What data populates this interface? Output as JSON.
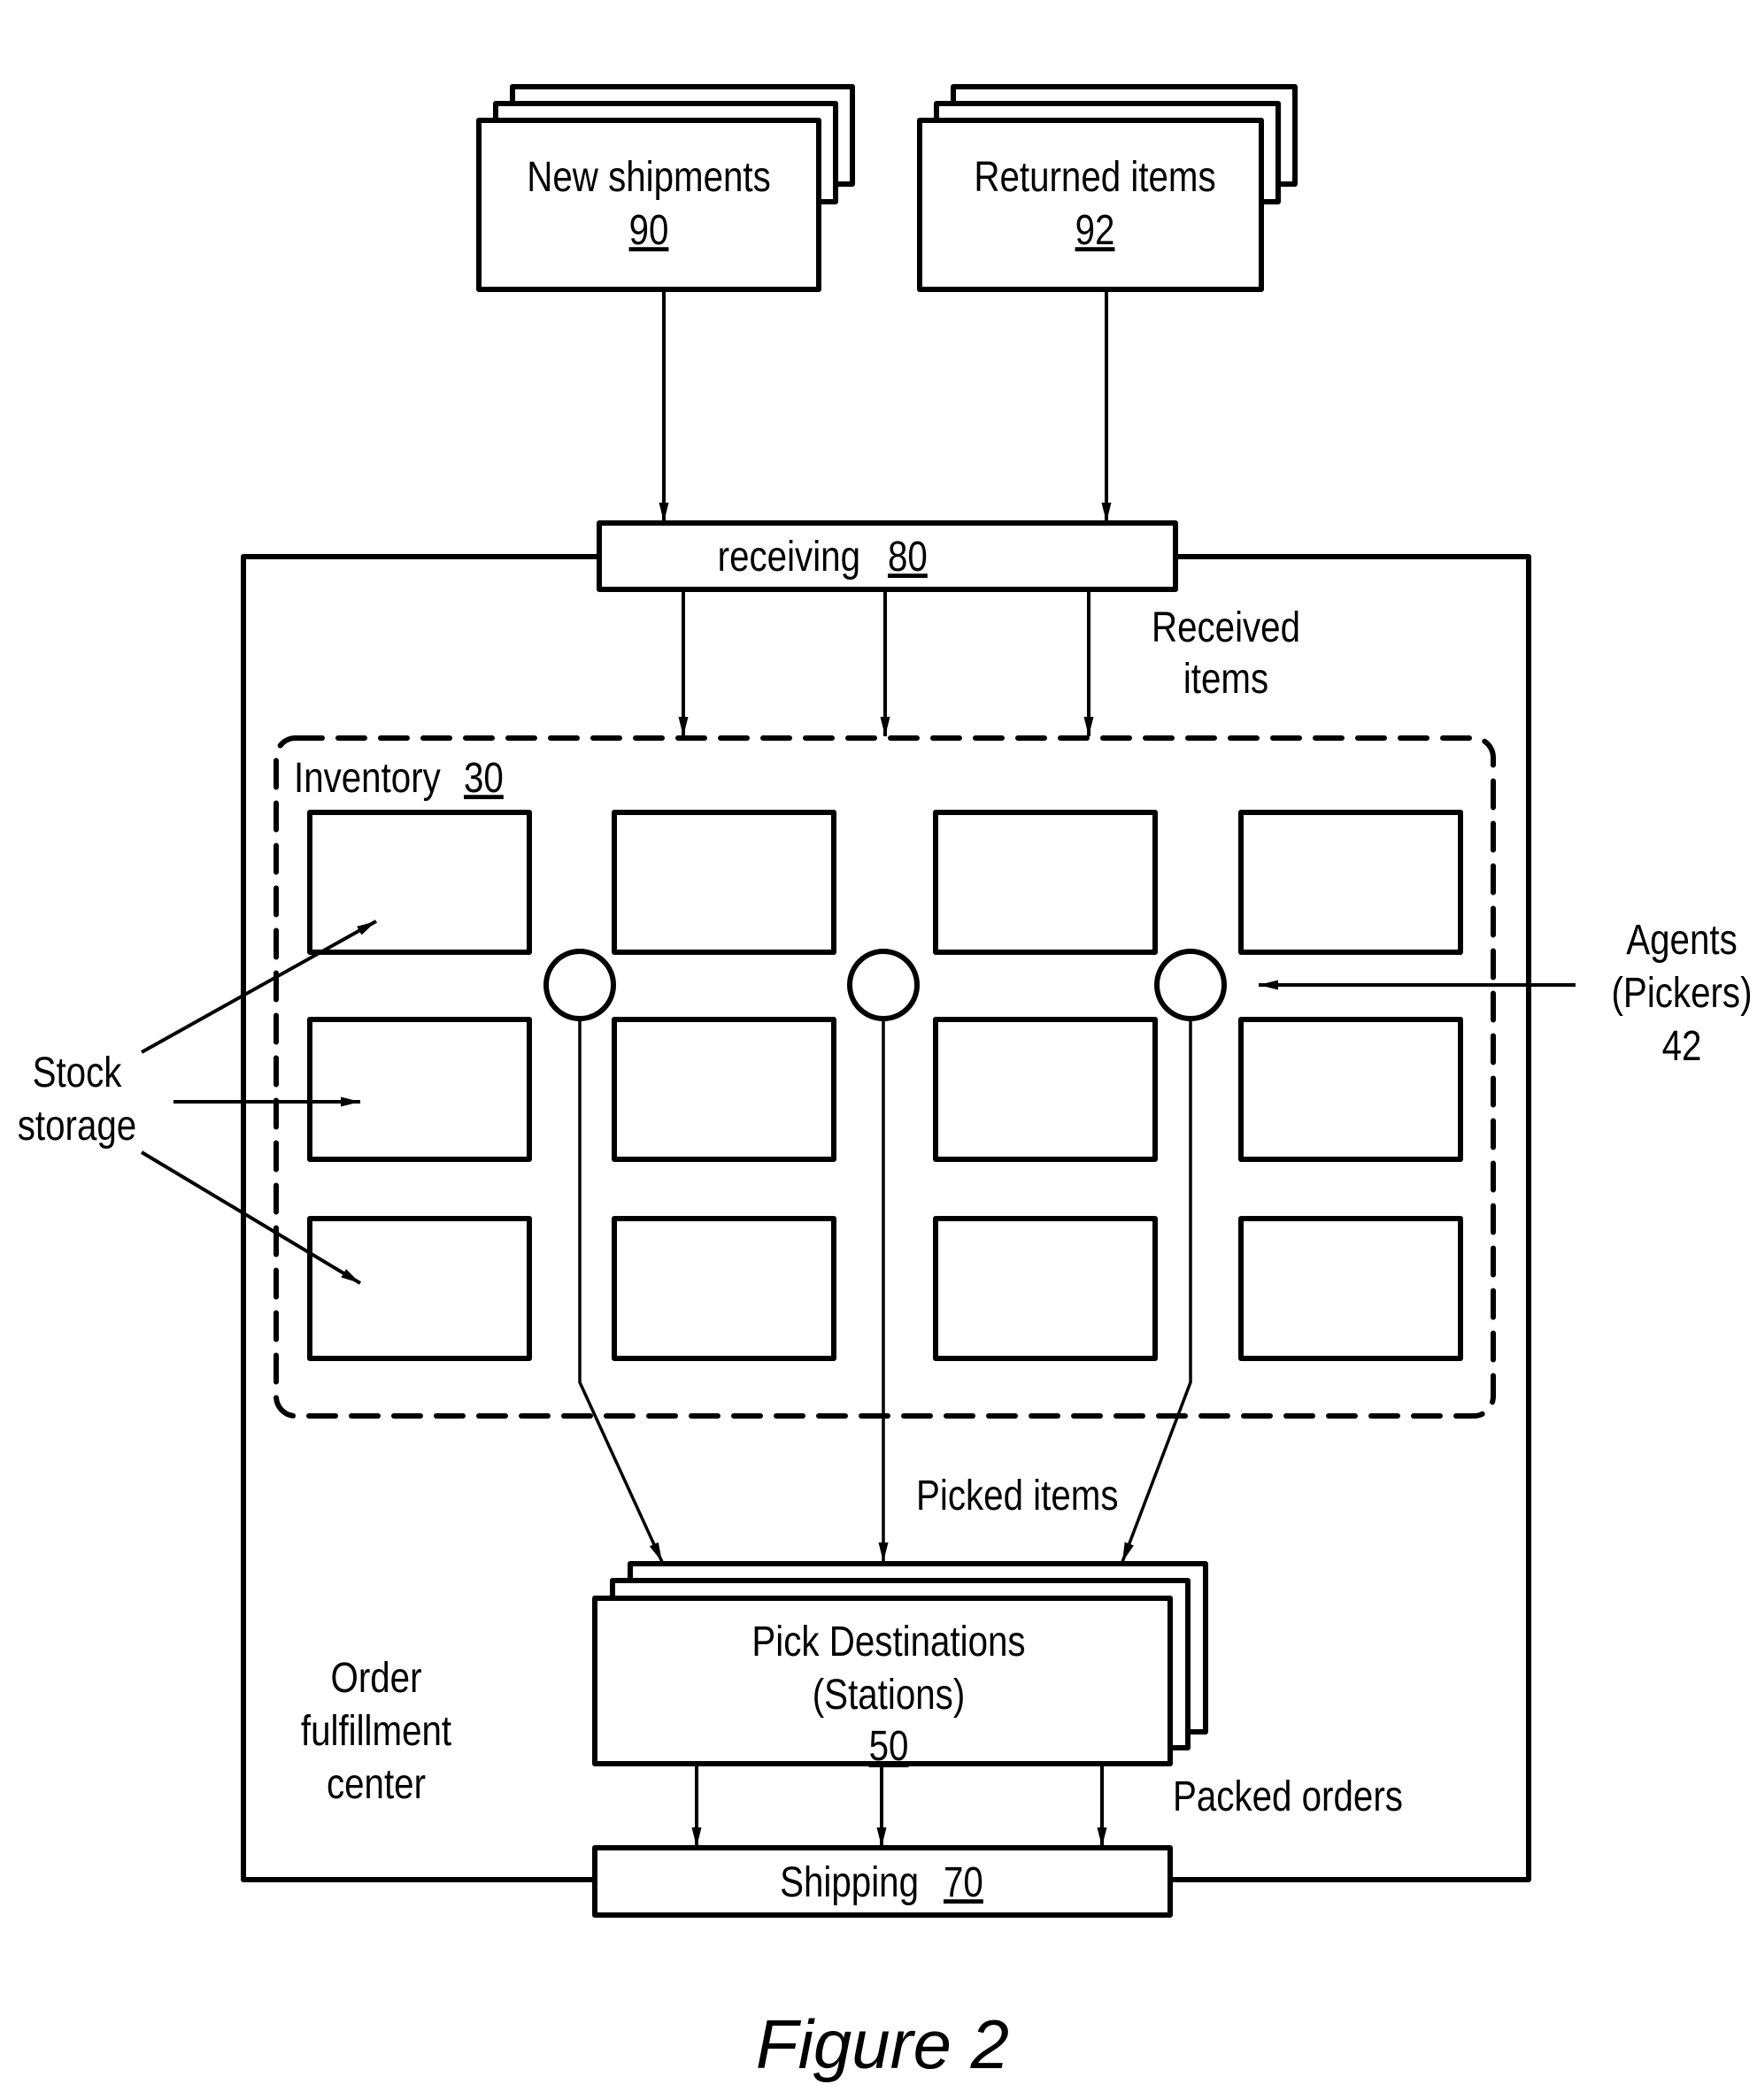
{
  "figure": {
    "caption": "Figure 2",
    "colors": {
      "line": "#000000",
      "background": "#ffffff"
    }
  },
  "sources": [
    {
      "label": "New shipments",
      "ref": "90"
    },
    {
      "label": "Returned items",
      "ref": "92"
    }
  ],
  "receiving": {
    "label": "receiving",
    "ref": "80"
  },
  "received_items_label": [
    "Received",
    "items"
  ],
  "inventory": {
    "label": "Inventory",
    "ref": "30",
    "storage_rows": 3,
    "storage_cols": 4
  },
  "stock_storage_label": [
    "Stock",
    "storage"
  ],
  "agents_label": [
    "Agents",
    "(Pickers)",
    "42"
  ],
  "agents_count": 3,
  "picked_items_label": "Picked items",
  "pick_destinations": {
    "lines": [
      "Pick Destinations",
      "(Stations)"
    ],
    "ref": "50"
  },
  "packed_orders_label": "Packed orders",
  "shipping": {
    "label": "Shipping",
    "ref": "70"
  },
  "facility_label": [
    "Order",
    "fulfillment",
    "center"
  ]
}
